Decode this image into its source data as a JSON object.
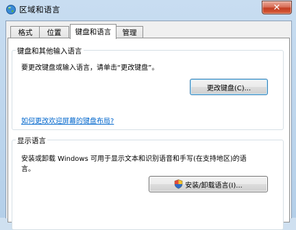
{
  "window": {
    "title": "区域和语言",
    "close_glyph": "✕"
  },
  "tabs": [
    {
      "label": "格式",
      "active": false
    },
    {
      "label": "位置",
      "active": false
    },
    {
      "label": "键盘和语言",
      "active": true
    },
    {
      "label": "管理",
      "active": false
    }
  ],
  "keyboards": {
    "title": "键盘和其他输入语言",
    "description": "要更改键盘或输入语言，请单击“更改键盘”。",
    "change_button": "更改键盘(C)...",
    "help_link": "如何更改欢迎屏幕的键盘布局?"
  },
  "display_language": {
    "title": "显示语言",
    "description_line1": "安装或卸载 Windows 可用于显示文本和识别语音和手写(在支持地区)的语",
    "description_line2": "言。",
    "install_button": "安装/卸载语言(I)..."
  },
  "colors": {
    "link": "#0066cc",
    "close": "#c33e23"
  },
  "icons": {
    "title": "globe-icon",
    "button": "shield-icon"
  }
}
